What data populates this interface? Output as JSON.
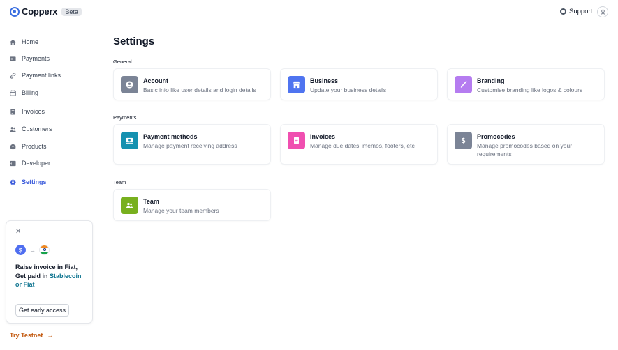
{
  "app": {
    "name": "Copperx",
    "badge": "Beta"
  },
  "header": {
    "support_label": "Support"
  },
  "sidebar": {
    "items": [
      {
        "label": "Home",
        "icon": "home-icon"
      },
      {
        "label": "Payments",
        "icon": "payments-icon"
      },
      {
        "label": "Payment links",
        "icon": "link-icon"
      },
      {
        "label": "Billing",
        "icon": "billing-icon"
      },
      {
        "label": "Invoices",
        "icon": "invoice-icon"
      },
      {
        "label": "Customers",
        "icon": "customers-icon"
      },
      {
        "label": "Products",
        "icon": "box-icon"
      },
      {
        "label": "Developer",
        "icon": "code-icon"
      },
      {
        "label": "Settings",
        "icon": "gear-icon",
        "active": true
      }
    ],
    "promo": {
      "coin_symbol": "$",
      "line1": "Raise invoice in Fiat,",
      "line2_prefix": "Get paid in ",
      "line2_highlight": "Stablecoin or Fiat",
      "button_label": "Get early access"
    },
    "testnet_label": "Try Testnet"
  },
  "main": {
    "title": "Settings",
    "sections": [
      {
        "label": "General",
        "cards": [
          {
            "title": "Account",
            "description": "Basic info like user details and login details",
            "icon": "user-circle-icon",
            "color": "#7b8496"
          },
          {
            "title": "Business",
            "description": "Update your business details",
            "icon": "store-icon",
            "color": "#4f74f0"
          },
          {
            "title": "Branding",
            "description": "Customise branding like logos & colours",
            "icon": "brush-icon",
            "color": "#b57cf0"
          }
        ]
      },
      {
        "label": "Payments",
        "cards": [
          {
            "title": "Payment methods",
            "description": "Manage payment receiving address",
            "icon": "payment-method-icon",
            "color": "#1491b0"
          },
          {
            "title": "Invoices",
            "description": "Manage due dates, memos, footers, etc",
            "icon": "document-icon",
            "color": "#f04fb0"
          },
          {
            "title": "Promocodes",
            "description": "Manage promocodes based on your requirements",
            "icon": "dollar-icon",
            "color": "#7b8496"
          }
        ]
      },
      {
        "label": "Team",
        "cards": [
          {
            "title": "Team",
            "description": "Manage your team members",
            "icon": "team-icon",
            "color": "#78b01e"
          }
        ]
      }
    ]
  }
}
